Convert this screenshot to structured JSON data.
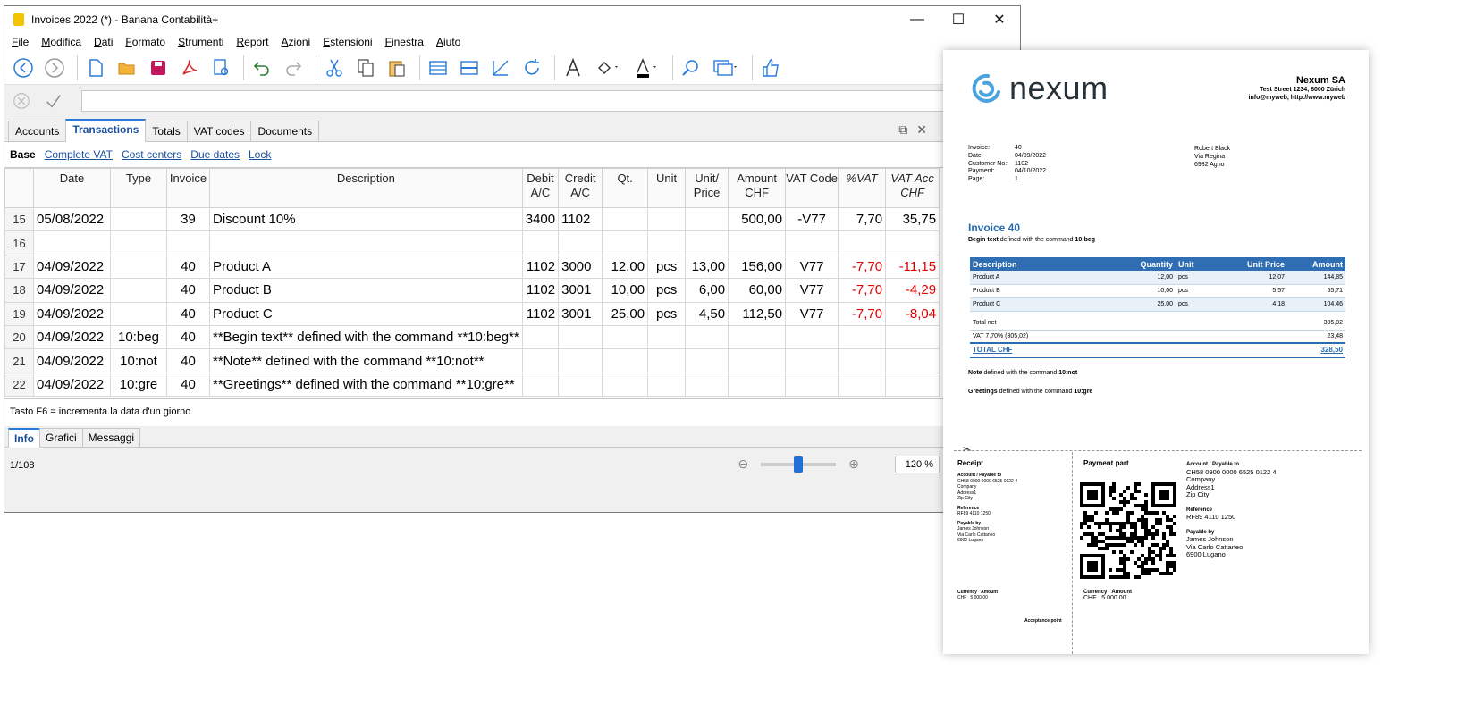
{
  "window": {
    "title": "Invoices 2022 (*) - Banana Contabilità+",
    "controls": [
      "—",
      "☐",
      "✕"
    ]
  },
  "menu": [
    "File",
    "Modifica",
    "Dati",
    "Formato",
    "Strumenti",
    "Report",
    "Azioni",
    "Estensioni",
    "Finestra",
    "Aiuto"
  ],
  "tabs": [
    "Accounts",
    "Transactions",
    "Totals",
    "VAT codes",
    "Documents"
  ],
  "views": [
    "Base",
    "Complete VAT",
    "Cost centers",
    "Due dates",
    "Lock"
  ],
  "columns": [
    {
      "label": "",
      "w": 32
    },
    {
      "label": "Date",
      "w": 86
    },
    {
      "label": "Type",
      "w": 63
    },
    {
      "label": "Invoice",
      "w": 48
    },
    {
      "label": "Description",
      "w": 349
    },
    {
      "label": "Debit A/C",
      "w": 40
    },
    {
      "label": "Credit A/C",
      "w": 49
    },
    {
      "label": "Qt.",
      "w": 51
    },
    {
      "label": "Unit",
      "w": 42
    },
    {
      "label": "Unit/ Price",
      "w": 48
    },
    {
      "label": "Amount CHF",
      "w": 64
    },
    {
      "label": "VAT Code",
      "w": 59
    },
    {
      "label": "%VAT",
      "w": 53
    },
    {
      "label": "VAT Acc CHF",
      "w": 60
    }
  ],
  "rows": [
    [
      "15",
      "05/08/2022",
      "",
      "39",
      "Discount 10%",
      "3400",
      "1102",
      "",
      "",
      "",
      "500,00",
      "-V77",
      "7,70",
      "35,75"
    ],
    [
      "16",
      "",
      "",
      "",
      "",
      "",
      "",
      "",
      "",
      "",
      "",
      "",
      "",
      ""
    ],
    [
      "17",
      "04/09/2022",
      "",
      "40",
      "Product A",
      "1102",
      "3000",
      "12,00",
      "pcs",
      "13,00",
      "156,00",
      "V77",
      "-7,70",
      "-11,15"
    ],
    [
      "18",
      "04/09/2022",
      "",
      "40",
      "Product B",
      "1102",
      "3001",
      "10,00",
      "pcs",
      "6,00",
      "60,00",
      "V77",
      "-7,70",
      "-4,29"
    ],
    [
      "19",
      "04/09/2022",
      "",
      "40",
      "Product C",
      "1102",
      "3001",
      "25,00",
      "pcs",
      "4,50",
      "112,50",
      "V77",
      "-7,70",
      "-8,04"
    ],
    [
      "20",
      "04/09/2022",
      "10:beg",
      "40",
      "**Begin text** defined with the command **10:beg**",
      "",
      "",
      "",
      "",
      "",
      "",
      "",
      "",
      ""
    ],
    [
      "21",
      "04/09/2022",
      "10:not",
      "40",
      "**Note** defined with the command **10:not**",
      "",
      "",
      "",
      "",
      "",
      "",
      "",
      "",
      ""
    ],
    [
      "22",
      "04/09/2022",
      "10:gre",
      "40",
      "**Greetings** defined with the command **10:gre**",
      "",
      "",
      "",
      "",
      "",
      "",
      "",
      "",
      ""
    ]
  ],
  "status": {
    "hint": "Tasto F6 = incrementa la data d'un giorno",
    "bottom_tabs": [
      "Info",
      "Grafici",
      "Messaggi"
    ],
    "position": "1/108",
    "zoom_level": 0.5,
    "zoom": "120 %"
  },
  "invoice": {
    "logo_text": "nexum",
    "company": "Nexum SA",
    "company_address": "Test Street 1234, 8000 Zürich",
    "company_contact": "info@myweb, http://www.myweb",
    "info": [
      {
        "label": "Invoice:",
        "value": "40"
      },
      {
        "label": "Date:",
        "value": "04/09/2022"
      },
      {
        "label": "Customer No:",
        "value": "1102"
      },
      {
        "label": "Payment:",
        "value": "04/10/2022"
      },
      {
        "label": "Page:",
        "value": "1"
      }
    ],
    "customer": [
      "Robert Black",
      "Via Regina",
      "6982 Agno"
    ],
    "title": "Invoice 40",
    "begin_text_label": "Begin text",
    "begin_text_mid": "defined with the command",
    "begin_text_cmd": "10:beg",
    "table_headers": [
      "Description",
      "Quantity",
      "Unit",
      "Unit Price",
      "Amount"
    ],
    "items": [
      [
        "Product A",
        "12,00",
        "pcs",
        "12,07",
        "144,85"
      ],
      [
        "Product B",
        "10,00",
        "pcs",
        "5,57",
        "55,71"
      ],
      [
        "Product C",
        "25,00",
        "pcs",
        "4,18",
        "104,46"
      ]
    ],
    "total_net_label": "Total net",
    "total_net": "305,02",
    "vat_label": "VAT 7.70% (305,02)",
    "vat": "23,48",
    "total_label": "TOTAL CHF",
    "total": "328,50",
    "note_label": "Note",
    "note_mid": "defined with the command",
    "note_cmd": "10:not",
    "greet_label": "Greetings",
    "greet_mid": "defined with the command",
    "greet_cmd": "10:gre"
  },
  "qr_bill": {
    "receipt_title": "Receipt",
    "payment_title": "Payment part",
    "account_label": "Account / Payable to",
    "iban": "CH58 0900 0000 6525 0122 4",
    "payee": [
      "Company",
      "Address1",
      "Zip City"
    ],
    "reference_label": "Reference",
    "reference": "RF89 4110 1250",
    "payable_by_label": "Payable by",
    "payer": [
      "James Johnson",
      "Via Carlo Cattaneo",
      "6900 Lugano"
    ],
    "currency_label": "Currency",
    "amount_label": "Amount",
    "currency": "CHF",
    "amount": "5 000.00",
    "acceptance": "Acceptance point"
  }
}
